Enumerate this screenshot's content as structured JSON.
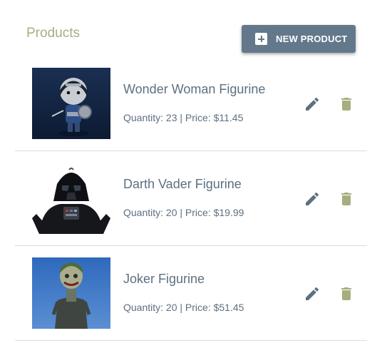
{
  "header": {
    "title": "Products",
    "new_button_label": "NEW PRODUCT"
  },
  "colors": {
    "title": "#a8ad80",
    "button": "#64788c",
    "text": "#5d7081",
    "delete_icon": "#a8ad80",
    "edit_icon": "#5d7081"
  },
  "products": [
    {
      "name": "Wonder Woman Figurine",
      "details": "Quantity: 23 | Price: $11.45",
      "edit_icon": "pencil-icon",
      "delete_icon": "trash-icon"
    },
    {
      "name": "Darth Vader Figurine",
      "details": "Quantity: 20 | Price: $19.99",
      "edit_icon": "pencil-icon",
      "delete_icon": "trash-icon"
    },
    {
      "name": "Joker Figurine",
      "details": "Quantity: 20 | Price: $51.45",
      "edit_icon": "pencil-icon",
      "delete_icon": "trash-icon"
    }
  ]
}
